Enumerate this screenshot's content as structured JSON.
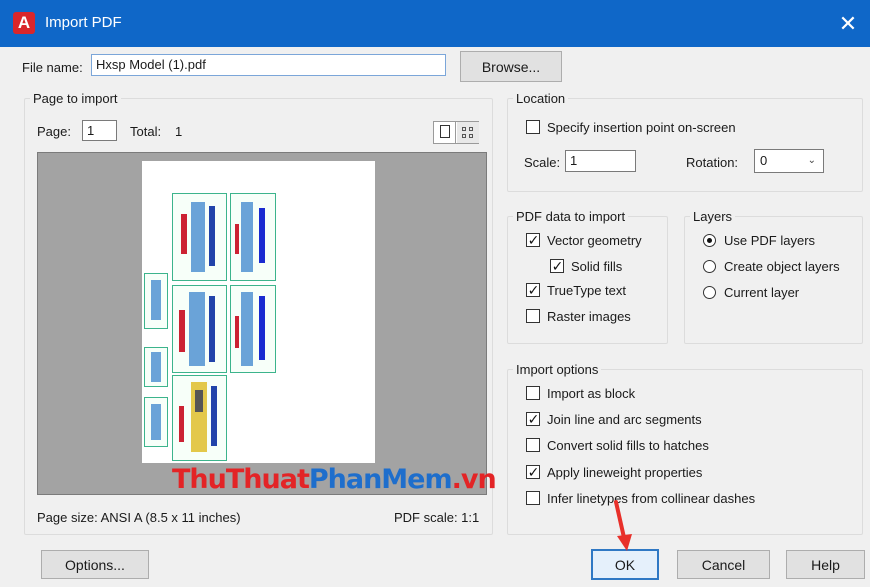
{
  "window": {
    "title": "Import PDF",
    "app_icon": "A",
    "close_glyph": "✕"
  },
  "file": {
    "label": "File name:",
    "value": "Hxsp Model (1).pdf",
    "browse_label": "Browse..."
  },
  "page_to_import": {
    "title": "Page to import",
    "page_label": "Page:",
    "page_value": "1",
    "total_label": "Total:",
    "total_value": "1",
    "page_size": "Page size:  ANSI A (8.5 x 11 inches)",
    "pdf_scale": "PDF scale:  1:1"
  },
  "location": {
    "title": "Location",
    "specify_label": "Specify insertion point on-screen",
    "specify_checked": false,
    "scale_label": "Scale:",
    "scale_value": "1",
    "rotation_label": "Rotation:",
    "rotation_value": "0"
  },
  "pdf_data": {
    "title": "PDF data to import",
    "items": [
      {
        "label": "Vector geometry",
        "checked": true
      },
      {
        "label": "Solid fills",
        "checked": true
      },
      {
        "label": "TrueType text",
        "checked": true
      },
      {
        "label": "Raster images",
        "checked": false
      }
    ]
  },
  "layers": {
    "title": "Layers",
    "items": [
      {
        "label": "Use PDF layers",
        "selected": true
      },
      {
        "label": "Create object layers",
        "selected": false
      },
      {
        "label": "Current layer",
        "selected": false
      }
    ]
  },
  "import_options": {
    "title": "Import options",
    "items": [
      {
        "label": "Import as block",
        "checked": false
      },
      {
        "label": "Join line and arc segments",
        "checked": true
      },
      {
        "label": "Convert solid fills to hatches",
        "checked": false
      },
      {
        "label": "Apply lineweight properties",
        "checked": true
      },
      {
        "label": "Infer linetypes from collinear dashes",
        "checked": false
      }
    ]
  },
  "watermark": {
    "part1": "ThuThuat",
    "part2": "PhanMem",
    "part3": ".vn"
  },
  "buttons": {
    "options": "Options...",
    "ok": "OK",
    "cancel": "Cancel",
    "help": "Help"
  },
  "colors": {
    "titlebar": "#0f67c8",
    "accent_red": "#e32426",
    "focus_blue": "#2f78c4"
  }
}
